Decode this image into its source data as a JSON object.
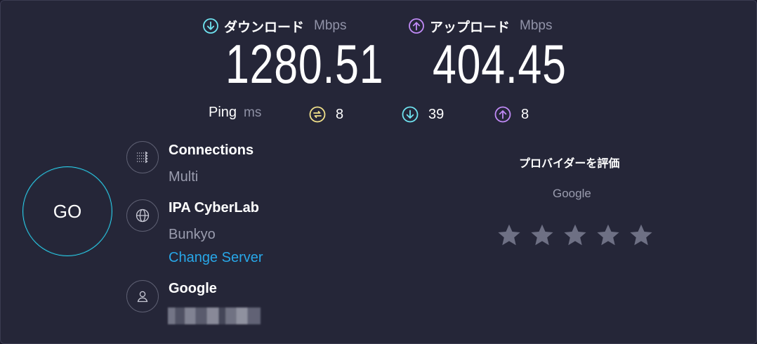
{
  "download": {
    "label": "ダウンロード",
    "unit": "Mbps",
    "value": "1280.51",
    "icon": "arrow-down-circle-icon",
    "color": "#6fe3f0"
  },
  "upload": {
    "label": "アップロード",
    "unit": "Mbps",
    "value": "404.45",
    "icon": "arrow-up-circle-icon",
    "color": "#c08af6"
  },
  "ping": {
    "label": "Ping",
    "unit": "ms",
    "idle": {
      "value": "8",
      "icon": "jitter-circle-icon",
      "color": "#f0e08a"
    },
    "down": {
      "value": "39",
      "icon": "arrow-down-circle-icon",
      "color": "#6fe3f0"
    },
    "up": {
      "value": "8",
      "icon": "arrow-up-circle-icon",
      "color": "#c08af6"
    }
  },
  "go_button": {
    "label": "GO",
    "color": "#2ad0ec"
  },
  "connections": {
    "title": "Connections",
    "value": "Multi",
    "icon": "connections-arrows-icon"
  },
  "server": {
    "title": "IPA CyberLab",
    "location": "Bunkyo",
    "change_label": "Change Server",
    "icon": "globe-icon"
  },
  "provider": {
    "title": "Google",
    "icon": "user-icon"
  },
  "rating": {
    "title": "プロバイダーを評価",
    "provider": "Google",
    "stars": 5,
    "star_color": "#6e7084"
  }
}
